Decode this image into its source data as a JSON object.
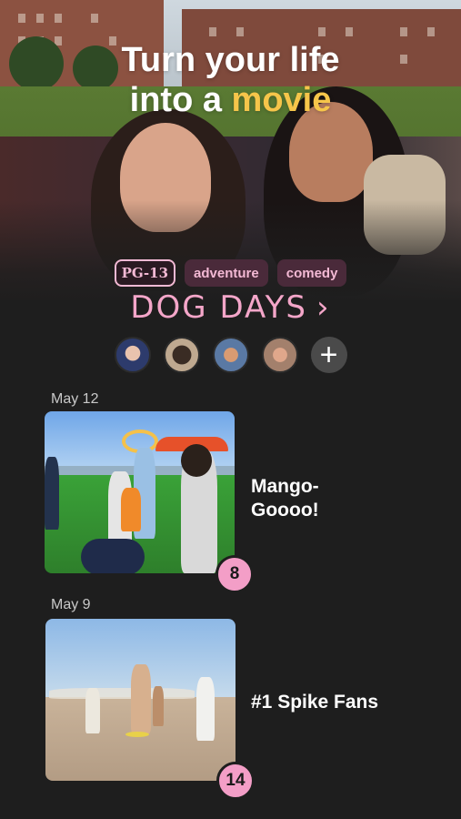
{
  "hero": {
    "headline_line1": "Turn your life",
    "headline_line2_prefix": "into a ",
    "headline_line2_accent": "movie"
  },
  "movie": {
    "rating": "PG-13",
    "genres": [
      "adventure",
      "comedy"
    ],
    "title": "DOG DAYS",
    "title_chevron": "›"
  },
  "cast": {
    "avatars": [
      "avatar-1",
      "avatar-2",
      "avatar-3",
      "avatar-4"
    ],
    "add_label": "+"
  },
  "entries": [
    {
      "date": "May 12",
      "title": "Mango-\nGoooo!",
      "count": "8"
    },
    {
      "date": "May 9",
      "title": "#1 Spike Fans",
      "count": "14"
    }
  ],
  "colors": {
    "background": "#1e1e1e",
    "accent_yellow": "#f6c54a",
    "accent_pink": "#f39ec7",
    "tag_bg": "#4a2a3a"
  }
}
